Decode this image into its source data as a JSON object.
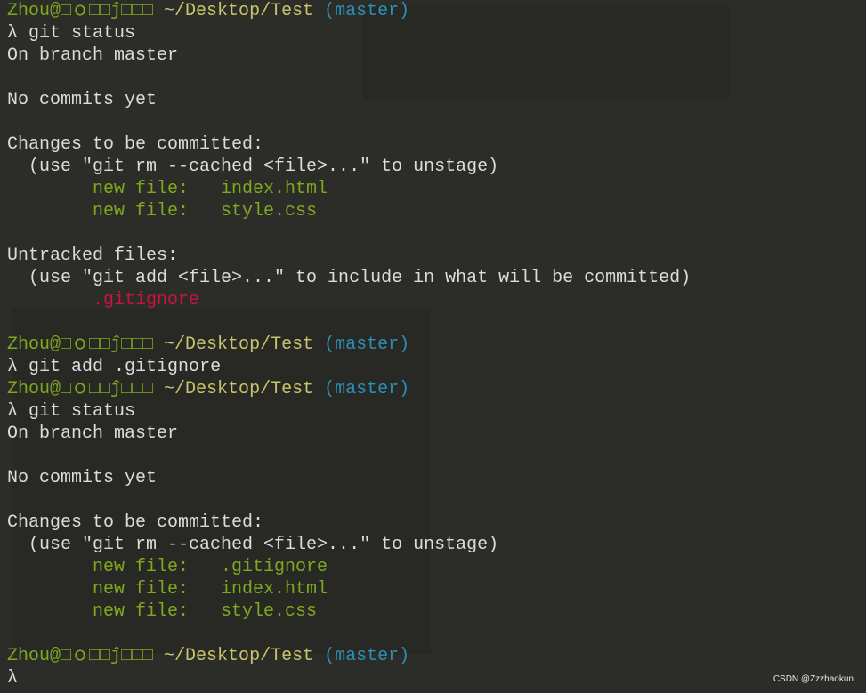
{
  "colors": {
    "background": "#2c2d28",
    "user": "#80a81e",
    "path": "#c9c46b",
    "branch": "#2b90b8",
    "text": "#dcdcdc",
    "staged": "#80a81e",
    "untracked": "#c8143f"
  },
  "prompt": {
    "user": "Zhou@□ｏ□□ĵ□□□",
    "path": "~/Desktop/Test",
    "branch": "(master)",
    "symbol": "λ"
  },
  "lines": [
    {
      "type": "prompt"
    },
    {
      "type": "cmd",
      "text": "git status"
    },
    {
      "type": "out",
      "text": "On branch master"
    },
    {
      "type": "out",
      "text": ""
    },
    {
      "type": "out",
      "text": "No commits yet"
    },
    {
      "type": "out",
      "text": ""
    },
    {
      "type": "out",
      "text": "Changes to be committed:"
    },
    {
      "type": "out",
      "text": "  (use \"git rm --cached <file>...\" to unstage)"
    },
    {
      "type": "staged",
      "text": "        new file:   index.html"
    },
    {
      "type": "staged",
      "text": "        new file:   style.css"
    },
    {
      "type": "out",
      "text": ""
    },
    {
      "type": "out",
      "text": "Untracked files:"
    },
    {
      "type": "out",
      "text": "  (use \"git add <file>...\" to include in what will be committed)"
    },
    {
      "type": "untracked",
      "text": "        .gitignore"
    },
    {
      "type": "out",
      "text": ""
    },
    {
      "type": "prompt"
    },
    {
      "type": "cmd",
      "text": "git add .gitignore"
    },
    {
      "type": "prompt"
    },
    {
      "type": "cmd",
      "text": "git status"
    },
    {
      "type": "out",
      "text": "On branch master"
    },
    {
      "type": "out",
      "text": ""
    },
    {
      "type": "out",
      "text": "No commits yet"
    },
    {
      "type": "out",
      "text": ""
    },
    {
      "type": "out",
      "text": "Changes to be committed:"
    },
    {
      "type": "out",
      "text": "  (use \"git rm --cached <file>...\" to unstage)"
    },
    {
      "type": "staged",
      "text": "        new file:   .gitignore"
    },
    {
      "type": "staged",
      "text": "        new file:   index.html"
    },
    {
      "type": "staged",
      "text": "        new file:   style.css"
    },
    {
      "type": "out",
      "text": ""
    },
    {
      "type": "prompt"
    },
    {
      "type": "cmd",
      "text": ""
    }
  ],
  "watermark": "CSDN @Zzzhaokun"
}
